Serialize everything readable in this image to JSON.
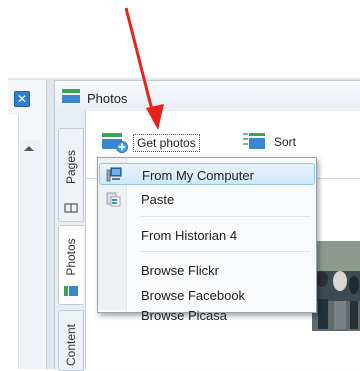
{
  "panel": {
    "title": "Photos"
  },
  "vertical_tabs": [
    {
      "label": "Pages",
      "active": false
    },
    {
      "label": "Photos",
      "active": true
    },
    {
      "label": "Content",
      "active": false
    }
  ],
  "toolbar": {
    "get_photos_label": "Get photos",
    "sort_label": "Sort"
  },
  "menu": {
    "items": [
      {
        "label": "From My Computer",
        "icon": "computer-icon",
        "highlighted": true
      },
      {
        "label": "Paste",
        "icon": "paste-icon",
        "highlighted": false
      },
      {
        "label": "From Historian 4",
        "icon": "",
        "highlighted": false
      },
      {
        "label": "Browse Flickr",
        "icon": "",
        "highlighted": false
      },
      {
        "label": "Browse Facebook",
        "icon": "",
        "highlighted": false
      },
      {
        "label": "Browse Picasa",
        "icon": "",
        "highlighted": false
      }
    ]
  },
  "colors": {
    "annotation_arrow": "#e8231c",
    "menu_highlight": "#cfe7f9",
    "close_button": "#2f7fd0",
    "tab_icon_green": "#3aa655"
  }
}
